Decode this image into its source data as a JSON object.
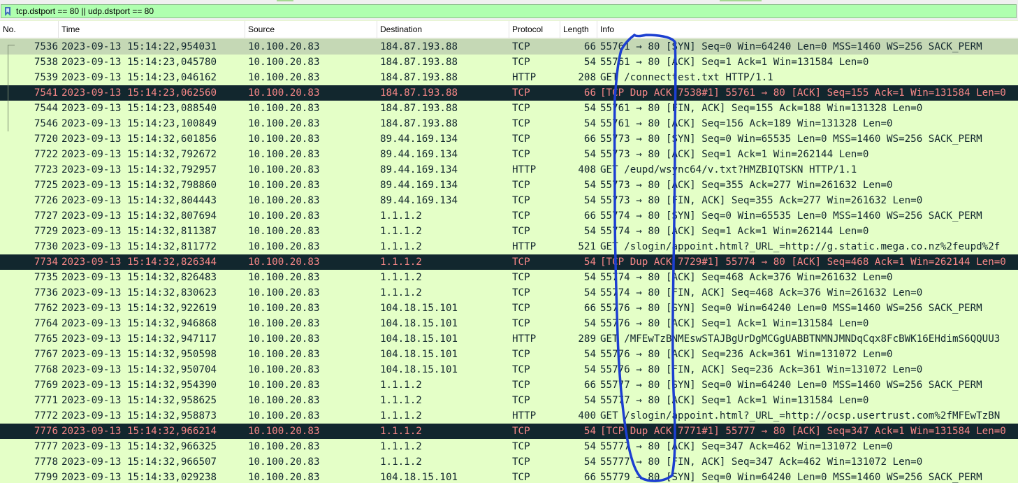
{
  "filter": {
    "value": "tcp.dstport == 80 || udp.dstport == 80",
    "bar_color": "#afffaf"
  },
  "columns": [
    "No.",
    "Time",
    "Source",
    "Destination",
    "Protocol",
    "Length",
    "Info"
  ],
  "colors": {
    "row_bg": "#e4ffc7",
    "selected_bg": "#c5d8b5",
    "dark_bg": "#12272e",
    "dark_fg": "#f78787",
    "annotation": "#1c3fd1"
  },
  "packets": [
    {
      "no": "7536",
      "time": "2023-09-13 15:14:22,954031",
      "src": "10.100.20.83",
      "dst": "184.87.193.88",
      "proto": "TCP",
      "len": "66",
      "info": "55761 → 80 [SYN] Seq=0 Win=64240 Len=0 MSS=1460 WS=256 SACK_PERM",
      "style": "sel"
    },
    {
      "no": "7538",
      "time": "2023-09-13 15:14:23,045780",
      "src": "10.100.20.83",
      "dst": "184.87.193.88",
      "proto": "TCP",
      "len": "54",
      "info": "55761 → 80 [ACK] Seq=1 Ack=1 Win=131584 Len=0",
      "style": ""
    },
    {
      "no": "7539",
      "time": "2023-09-13 15:14:23,046162",
      "src": "10.100.20.83",
      "dst": "184.87.193.88",
      "proto": "HTTP",
      "len": "208",
      "info": "GET /connecttest.txt HTTP/1.1",
      "style": ""
    },
    {
      "no": "7541",
      "time": "2023-09-13 15:14:23,062560",
      "src": "10.100.20.83",
      "dst": "184.87.193.88",
      "proto": "TCP",
      "len": "66",
      "info": "[TCP Dup ACK 7538#1] 55761 → 80 [ACK] Seq=155 Ack=1 Win=131584 Len=0",
      "style": "dark"
    },
    {
      "no": "7544",
      "time": "2023-09-13 15:14:23,088540",
      "src": "10.100.20.83",
      "dst": "184.87.193.88",
      "proto": "TCP",
      "len": "54",
      "info": "55761 → 80 [FIN, ACK] Seq=155 Ack=188 Win=131328 Len=0",
      "style": ""
    },
    {
      "no": "7546",
      "time": "2023-09-13 15:14:23,100849",
      "src": "10.100.20.83",
      "dst": "184.87.193.88",
      "proto": "TCP",
      "len": "54",
      "info": "55761 → 80 [ACK] Seq=156 Ack=189 Win=131328 Len=0",
      "style": ""
    },
    {
      "no": "7720",
      "time": "2023-09-13 15:14:32,601856",
      "src": "10.100.20.83",
      "dst": "89.44.169.134",
      "proto": "TCP",
      "len": "66",
      "info": "55773 → 80 [SYN] Seq=0 Win=65535 Len=0 MSS=1460 WS=256 SACK_PERM",
      "style": ""
    },
    {
      "no": "7722",
      "time": "2023-09-13 15:14:32,792672",
      "src": "10.100.20.83",
      "dst": "89.44.169.134",
      "proto": "TCP",
      "len": "54",
      "info": "55773 → 80 [ACK] Seq=1 Ack=1 Win=262144 Len=0",
      "style": ""
    },
    {
      "no": "7723",
      "time": "2023-09-13 15:14:32,792957",
      "src": "10.100.20.83",
      "dst": "89.44.169.134",
      "proto": "HTTP",
      "len": "408",
      "info": "GET /eupd/wsync64/v.txt?HMZBIQTSKN HTTP/1.1",
      "style": ""
    },
    {
      "no": "7725",
      "time": "2023-09-13 15:14:32,798860",
      "src": "10.100.20.83",
      "dst": "89.44.169.134",
      "proto": "TCP",
      "len": "54",
      "info": "55773 → 80 [ACK] Seq=355 Ack=277 Win=261632 Len=0",
      "style": ""
    },
    {
      "no": "7726",
      "time": "2023-09-13 15:14:32,804443",
      "src": "10.100.20.83",
      "dst": "89.44.169.134",
      "proto": "TCP",
      "len": "54",
      "info": "55773 → 80 [FIN, ACK] Seq=355 Ack=277 Win=261632 Len=0",
      "style": ""
    },
    {
      "no": "7727",
      "time": "2023-09-13 15:14:32,807694",
      "src": "10.100.20.83",
      "dst": "1.1.1.2",
      "proto": "TCP",
      "len": "66",
      "info": "55774 → 80 [SYN] Seq=0 Win=65535 Len=0 MSS=1460 WS=256 SACK_PERM",
      "style": ""
    },
    {
      "no": "7729",
      "time": "2023-09-13 15:14:32,811387",
      "src": "10.100.20.83",
      "dst": "1.1.1.2",
      "proto": "TCP",
      "len": "54",
      "info": "55774 → 80 [ACK] Seq=1 Ack=1 Win=262144 Len=0",
      "style": ""
    },
    {
      "no": "7730",
      "time": "2023-09-13 15:14:32,811772",
      "src": "10.100.20.83",
      "dst": "1.1.1.2",
      "proto": "HTTP",
      "len": "521",
      "info": "GET /slogin/appoint.html?_URL_=http://g.static.mega.co.nz%2feupd%2f",
      "style": ""
    },
    {
      "no": "7734",
      "time": "2023-09-13 15:14:32,826344",
      "src": "10.100.20.83",
      "dst": "1.1.1.2",
      "proto": "TCP",
      "len": "54",
      "info": "[TCP Dup ACK 7729#1] 55774 → 80 [ACK] Seq=468 Ack=1 Win=262144 Len=0",
      "style": "dark"
    },
    {
      "no": "7735",
      "time": "2023-09-13 15:14:32,826483",
      "src": "10.100.20.83",
      "dst": "1.1.1.2",
      "proto": "TCP",
      "len": "54",
      "info": "55774 → 80 [ACK] Seq=468 Ack=376 Win=261632 Len=0",
      "style": ""
    },
    {
      "no": "7736",
      "time": "2023-09-13 15:14:32,830623",
      "src": "10.100.20.83",
      "dst": "1.1.1.2",
      "proto": "TCP",
      "len": "54",
      "info": "55774 → 80 [FIN, ACK] Seq=468 Ack=376 Win=261632 Len=0",
      "style": ""
    },
    {
      "no": "7762",
      "time": "2023-09-13 15:14:32,922619",
      "src": "10.100.20.83",
      "dst": "104.18.15.101",
      "proto": "TCP",
      "len": "66",
      "info": "55776 → 80 [SYN] Seq=0 Win=64240 Len=0 MSS=1460 WS=256 SACK_PERM",
      "style": ""
    },
    {
      "no": "7764",
      "time": "2023-09-13 15:14:32,946868",
      "src": "10.100.20.83",
      "dst": "104.18.15.101",
      "proto": "TCP",
      "len": "54",
      "info": "55776 → 80 [ACK] Seq=1 Ack=1 Win=131584 Len=0",
      "style": ""
    },
    {
      "no": "7765",
      "time": "2023-09-13 15:14:32,947117",
      "src": "10.100.20.83",
      "dst": "104.18.15.101",
      "proto": "HTTP",
      "len": "289",
      "info": "GET /MFEwTzBNMEswSTAJBgUrDgMCGgUABBTNMNJMNDqCqx8FcBWK16EHdimS6QQUU3",
      "style": ""
    },
    {
      "no": "7767",
      "time": "2023-09-13 15:14:32,950598",
      "src": "10.100.20.83",
      "dst": "104.18.15.101",
      "proto": "TCP",
      "len": "54",
      "info": "55776 → 80 [ACK] Seq=236 Ack=361 Win=131072 Len=0",
      "style": ""
    },
    {
      "no": "7768",
      "time": "2023-09-13 15:14:32,950704",
      "src": "10.100.20.83",
      "dst": "104.18.15.101",
      "proto": "TCP",
      "len": "54",
      "info": "55776 → 80 [FIN, ACK] Seq=236 Ack=361 Win=131072 Len=0",
      "style": ""
    },
    {
      "no": "7769",
      "time": "2023-09-13 15:14:32,954390",
      "src": "10.100.20.83",
      "dst": "1.1.1.2",
      "proto": "TCP",
      "len": "66",
      "info": "55777 → 80 [SYN] Seq=0 Win=64240 Len=0 MSS=1460 WS=256 SACK_PERM",
      "style": ""
    },
    {
      "no": "7771",
      "time": "2023-09-13 15:14:32,958625",
      "src": "10.100.20.83",
      "dst": "1.1.1.2",
      "proto": "TCP",
      "len": "54",
      "info": "55777 → 80 [ACK] Seq=1 Ack=1 Win=131584 Len=0",
      "style": ""
    },
    {
      "no": "7772",
      "time": "2023-09-13 15:14:32,958873",
      "src": "10.100.20.83",
      "dst": "1.1.1.2",
      "proto": "HTTP",
      "len": "400",
      "info": "GET /slogin/appoint.html?_URL_=http://ocsp.usertrust.com%2fMFEwTzBN",
      "style": ""
    },
    {
      "no": "7776",
      "time": "2023-09-13 15:14:32,966214",
      "src": "10.100.20.83",
      "dst": "1.1.1.2",
      "proto": "TCP",
      "len": "54",
      "info": "[TCP Dup ACK 7771#1] 55777 → 80 [ACK] Seq=347 Ack=1 Win=131584 Len=0",
      "style": "dark"
    },
    {
      "no": "7777",
      "time": "2023-09-13 15:14:32,966325",
      "src": "10.100.20.83",
      "dst": "1.1.1.2",
      "proto": "TCP",
      "len": "54",
      "info": "55777 → 80 [ACK] Seq=347 Ack=462 Win=131072 Len=0",
      "style": ""
    },
    {
      "no": "7778",
      "time": "2023-09-13 15:14:32,966507",
      "src": "10.100.20.83",
      "dst": "1.1.1.2",
      "proto": "TCP",
      "len": "54",
      "info": "55777 → 80 [FIN, ACK] Seq=347 Ack=462 Win=131072 Len=0",
      "style": ""
    },
    {
      "no": "7799",
      "time": "2023-09-13 15:14:33,029238",
      "src": "10.100.20.83",
      "dst": "104.18.15.101",
      "proto": "TCP",
      "len": "66",
      "info": "55779 → 80 [SYN] Seq=0 Win=64240 Len=0 MSS=1460 WS=256 SACK_PERM",
      "style": ""
    }
  ]
}
